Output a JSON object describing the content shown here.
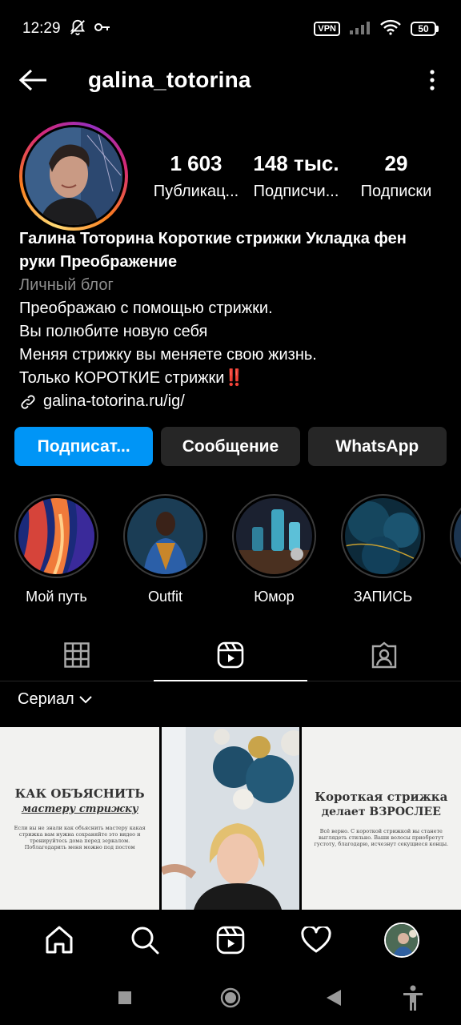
{
  "status_bar": {
    "time": "12:29",
    "vpn": "VPN",
    "battery": "50"
  },
  "header": {
    "username": "galina_totorina"
  },
  "profile": {
    "stats": [
      {
        "value": "1 603",
        "label": "Публикац..."
      },
      {
        "value": "148 тыс.",
        "label": "Подписчи..."
      },
      {
        "value": "29",
        "label": "Подписки"
      }
    ]
  },
  "bio": {
    "name": "Галина Тоторина Короткие стрижки Укладка фен руки Преображение",
    "category": "Личный блог",
    "lines": [
      "Преображаю с помощью стрижки.",
      "Вы полюбите новую себя",
      "Меняя стрижку вы меняете свою жизнь.",
      "Только КОРОТКИЕ стрижки‼️"
    ],
    "link": "galina-totorina.ru/ig/"
  },
  "actions": {
    "follow": "Подписат...",
    "message": "Сообщение",
    "whatsapp": "WhatsApp"
  },
  "highlights": [
    {
      "label": "Мой путь"
    },
    {
      "label": "Outfit"
    },
    {
      "label": "Юмор"
    },
    {
      "label": "ЗАПИСЬ"
    },
    {
      "label": ""
    }
  ],
  "tabs": {
    "active": "reels"
  },
  "series": {
    "label": "Сериал"
  },
  "grid": [
    {
      "title_line1": "КАК ОБЪЯСНИТЬ",
      "title_line2": "мастеру стрижку",
      "caption": "Если вы не знали как объяснить мастеру какая стрижка вам нужна сохраняйте это видео и тренируйтесь дома перед зеркалом. Поблагодарить меня можно под постом"
    },
    {},
    {
      "title_line1": "Короткая стрижка",
      "title_line2": "делает ВЗРОСЛЕЕ",
      "caption": "Всё верно. С короткой стрижкой вы станете выглядеть стильно. Ваши волосы приобретут густоту, благодарю, исчезнут секущиеся концы."
    }
  ],
  "colors": {
    "primary_button": "#0095f6",
    "secondary_button": "#262626",
    "background": "#000000"
  }
}
